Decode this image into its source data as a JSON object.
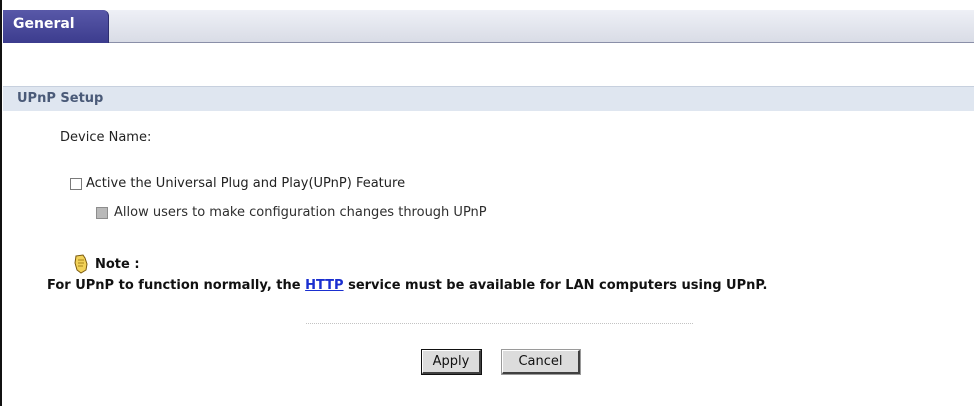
{
  "tabs": [
    {
      "label": "General",
      "active": true
    }
  ],
  "section": {
    "title": "UPnP Setup"
  },
  "form": {
    "device_name_label": "Device Name:",
    "upnp_feature_label": "Active the Universal Plug and Play(UPnP) Feature",
    "upnp_feature_checked": false,
    "allow_config_label": "Allow users to make configuration changes through UPnP",
    "allow_config_checked": false,
    "allow_config_disabled": true
  },
  "note": {
    "title": "Note :",
    "text_before": "For UPnP to function normally, the ",
    "link_text": "HTTP",
    "text_after": " service must be available for LAN computers using UPnP.",
    "icon": "note-hand-icon"
  },
  "buttons": {
    "apply": "Apply",
    "cancel": "Cancel"
  },
  "colors": {
    "tab_active": "#4a4a9c",
    "section_header_bg": "#dfe6f0",
    "link": "#1a2fd0"
  }
}
